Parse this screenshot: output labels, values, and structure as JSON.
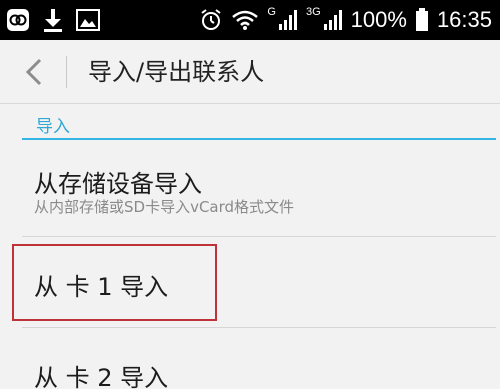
{
  "status_bar": {
    "icons_left": [
      "app-icon",
      "download-icon",
      "image-icon"
    ],
    "alarm_icon": "alarm-icon",
    "wifi_icon": "wifi-icon",
    "net1_label": "G",
    "net2_label": "3G",
    "signal_icon": "signal-icon",
    "battery_percent": "100%",
    "battery_icon": "battery-icon",
    "time": "16:35"
  },
  "action_bar": {
    "back_icon": "chevron-left-icon",
    "title": "导入/导出联系人"
  },
  "section": {
    "header": "导入"
  },
  "items": [
    {
      "title": "从存储设备导入",
      "subtitle": "从内部存储或SD卡导入vCard格式文件"
    },
    {
      "title": "从 卡 1 导入"
    },
    {
      "title": "从 卡 2 导入"
    }
  ],
  "colors": {
    "accent": "#33b5e5",
    "highlight": "#c0323a"
  }
}
